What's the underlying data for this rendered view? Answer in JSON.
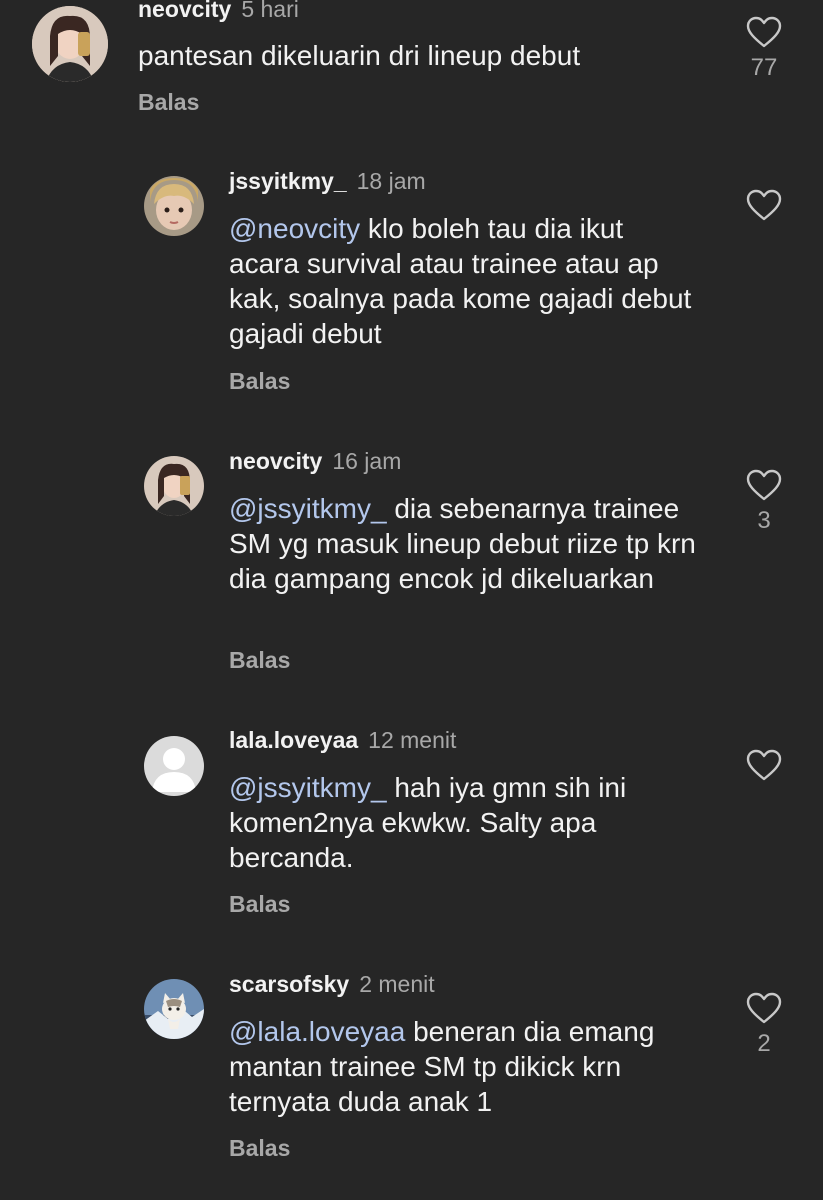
{
  "comments": [
    {
      "username": "neovcity",
      "time": "5 hari",
      "mention": "",
      "text": "pantesan dikeluarin dri lineup debut",
      "reply_label": "Balas",
      "likes": "77",
      "avatar": "girl-selfie"
    },
    {
      "username": "jssyitkmy_",
      "time": "18 jam",
      "mention": "@neovcity",
      "text": " klo boleh tau dia ikut acara survival atau trainee atau ap kak, soalnya pada kome gajadi debut gajadi debut",
      "reply_label": "Balas",
      "likes": "",
      "avatar": "girl-face"
    },
    {
      "username": "neovcity",
      "time": "16 jam",
      "mention": "@jssyitkmy_",
      "text": " dia sebenarnya trainee SM yg masuk lineup debut riize tp krn dia gampang encok jd dikeluarkan",
      "reply_label": "Balas",
      "likes": "3",
      "avatar": "girl-selfie"
    },
    {
      "username": "lala.loveyaa",
      "time": "12 menit",
      "mention": "@jssyitkmy_",
      "text": " hah iya gmn sih ini komen2nya ekwkw. Salty apa bercanda.",
      "reply_label": "Balas",
      "likes": "",
      "avatar": "default-user"
    },
    {
      "username": "scarsofsky",
      "time": "2 menit",
      "mention": "@lala.loveyaa",
      "text": " beneran dia emang mantan trainee SM tp dikick krn ternyata duda anak 1",
      "reply_label": "Balas",
      "likes": "2",
      "avatar": "cat-photo"
    }
  ],
  "colors": {
    "background": "#262626",
    "text": "#f2f2f2",
    "secondary": "#a8a8a8",
    "mention": "#b3c7ec"
  },
  "icons": {
    "like": "heart-outline-icon"
  }
}
